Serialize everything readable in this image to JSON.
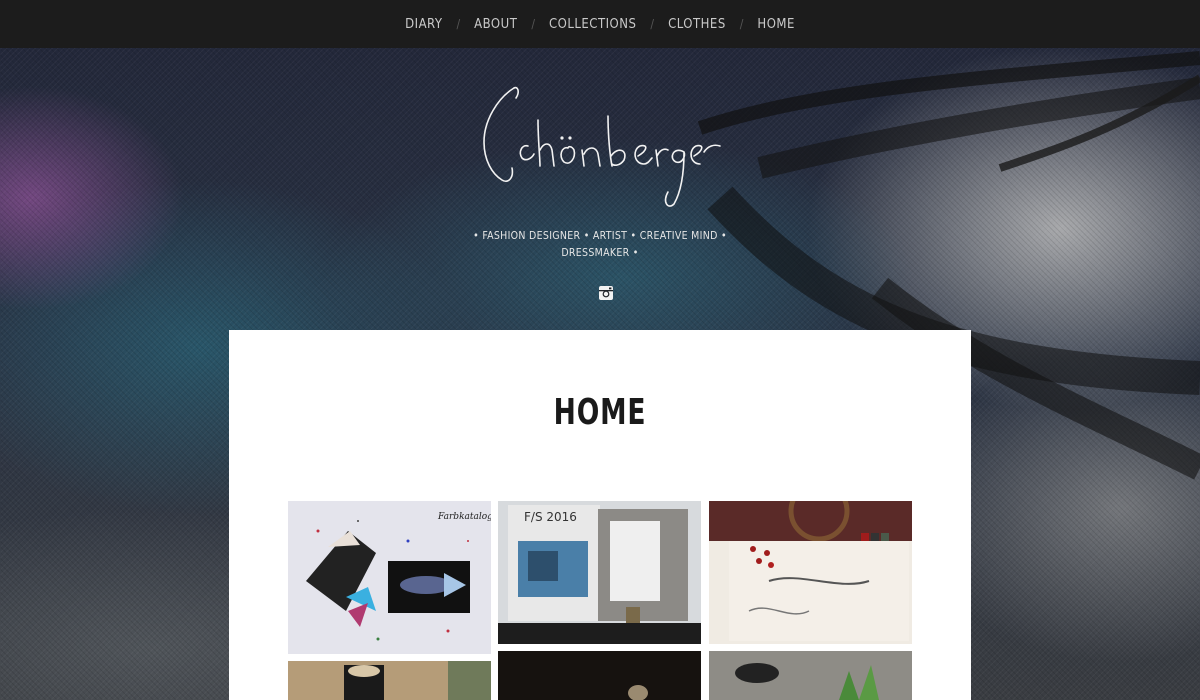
{
  "nav": {
    "items": [
      {
        "label": "DIARY"
      },
      {
        "label": "ABOUT"
      },
      {
        "label": "COLLECTIONS"
      },
      {
        "label": "CLOTHES"
      },
      {
        "label": "HOME"
      }
    ],
    "separator": "/"
  },
  "header": {
    "logo_text": "Schönberger",
    "tagline_line1": "• FASHION DESIGNER • ARTIST • CREATIVE MIND •",
    "tagline_line2": "DRESSMAKER •"
  },
  "social": {
    "icon": "instagram-icon"
  },
  "main": {
    "title": "HOME",
    "thumb1_caption": "Farbkatalog",
    "thumb2_caption": "F/S 2016"
  },
  "colors": {
    "nav_bg": "#1c1c1c",
    "nav_text": "#c9c9c9",
    "panel_bg": "#ffffff",
    "title_text": "#1a1a1a"
  }
}
